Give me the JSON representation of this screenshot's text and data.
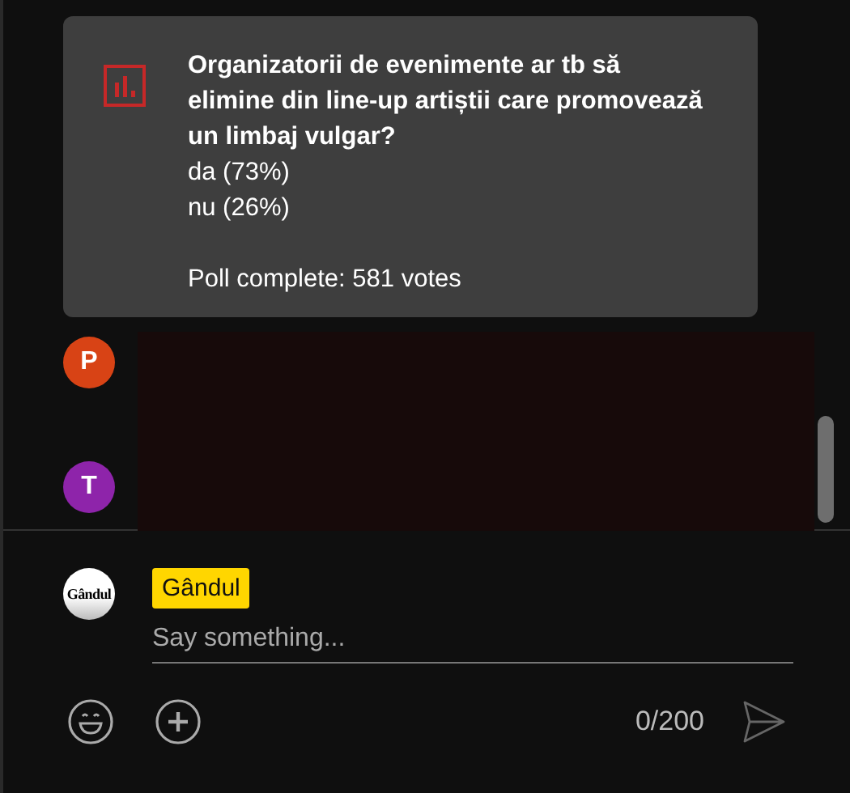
{
  "poll": {
    "question": "Organizatorii de evenimente ar tb să elimine din line-up artiștii care promovează un limbaj vulgar?",
    "options": [
      {
        "text": "da (73%)"
      },
      {
        "text": "nu (26%)"
      }
    ],
    "status": "Poll complete: 581 votes"
  },
  "messages": [
    {
      "initial": "P",
      "color": "#d84315"
    },
    {
      "initial": "T",
      "color": "#8e24aa"
    }
  ],
  "composer": {
    "avatar_text": "Gândul",
    "author": "Gândul",
    "placeholder": "Say something...",
    "counter": "0/200"
  }
}
